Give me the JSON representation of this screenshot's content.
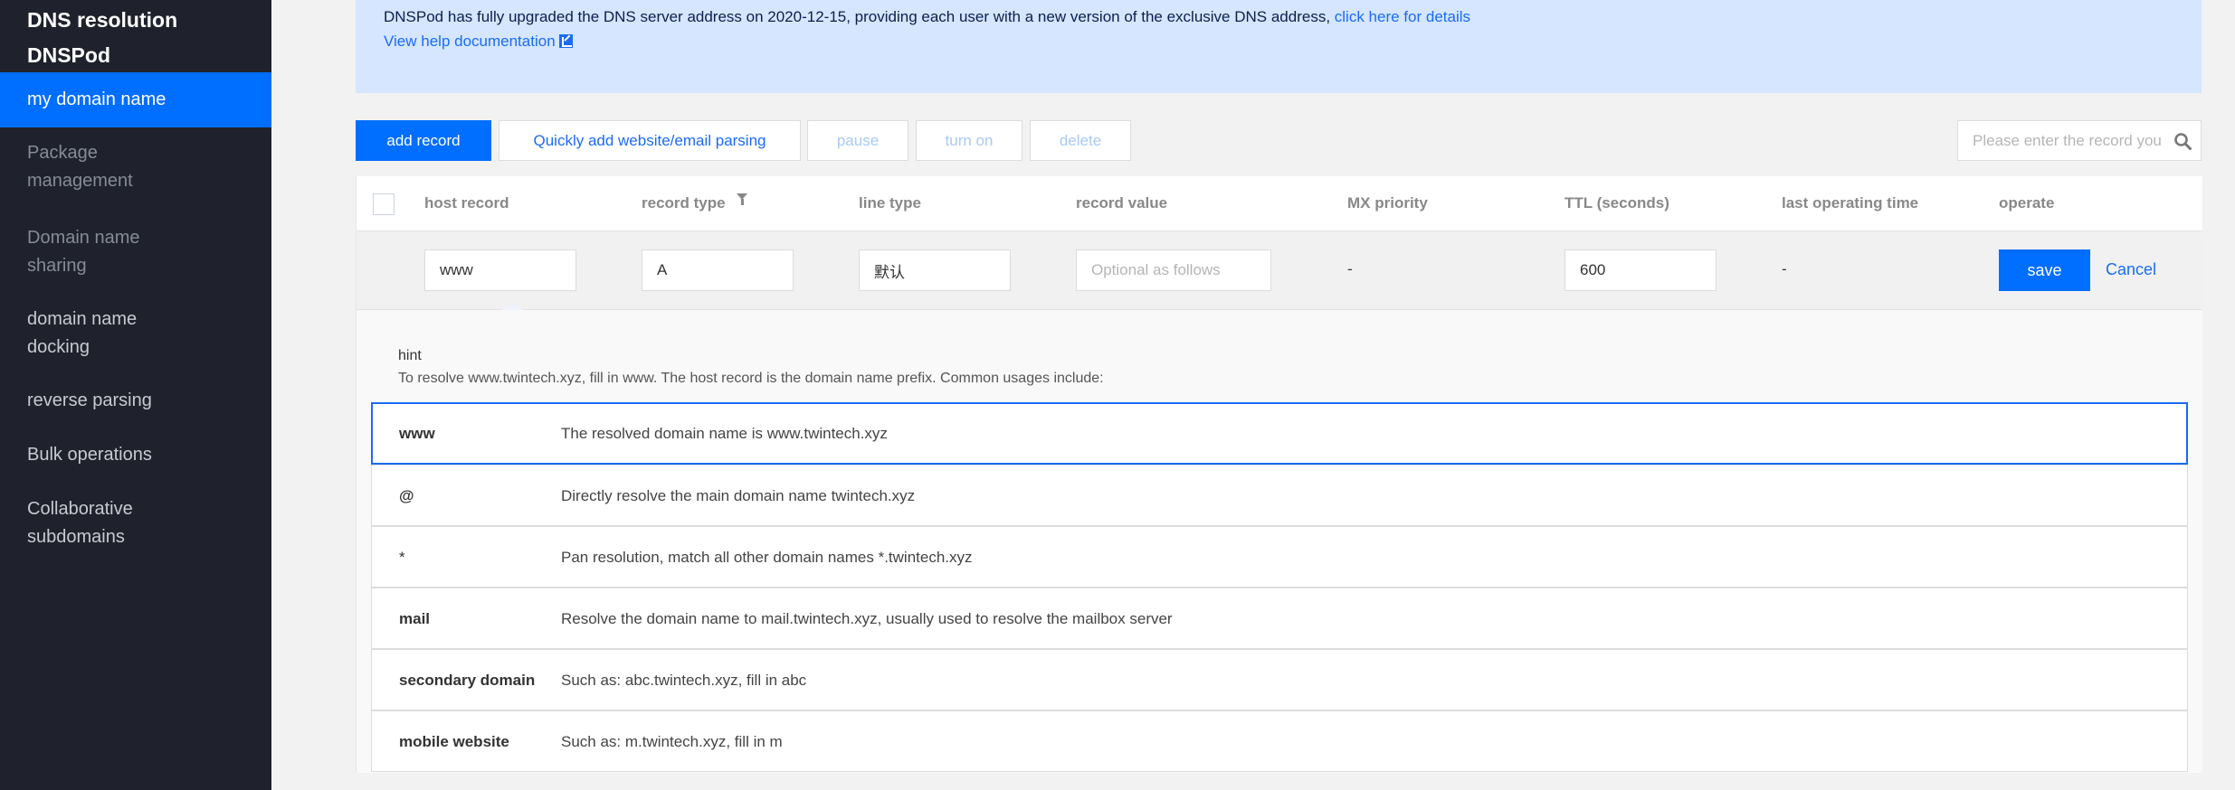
{
  "sidebar": {
    "title": "DNS resolution DNSPod",
    "items": [
      {
        "label": "my domain name",
        "active": true
      },
      {
        "label": "Package management",
        "muted": true
      },
      {
        "label": "Domain name sharing",
        "muted": true
      },
      {
        "label": "domain name docking"
      },
      {
        "label": "reverse parsing"
      },
      {
        "label": "Bulk operations"
      },
      {
        "label": "Collaborative subdomains"
      }
    ]
  },
  "notice": {
    "text": "DNSPod has fully upgraded the DNS server address on 2020-12-15, providing each user with a new version of the exclusive DNS address, ",
    "link": "click here for details",
    "help": "View help documentation",
    "icon": "external-link-icon",
    "close_icon": "close-icon"
  },
  "toolbar": {
    "add_record": "add record",
    "quick_add": "Quickly add website/email parsing",
    "pause": "pause",
    "turn_on": "turn on",
    "delete": "delete",
    "search_placeholder": "Please enter the record you want to search",
    "search_icon": "search-icon"
  },
  "table": {
    "columns": [
      "host record",
      "record type",
      "line type",
      "record value",
      "MX priority",
      "TTL (seconds)",
      "last operating time",
      "operate"
    ],
    "edit_row": {
      "host_record": "www",
      "record_type": "A",
      "line_type": "默认",
      "record_value_placeholder": "Optional as follows",
      "mx_priority": "-",
      "ttl": "600",
      "last_operating_time": "-",
      "save": "save",
      "cancel": "Cancel"
    }
  },
  "hint": {
    "title": "hint",
    "description": "To resolve www.twintech.xyz, fill in www. The host record is the domain name prefix. Common usages include:",
    "items": [
      {
        "key": "www",
        "value": "The resolved domain name is www.twintech.xyz"
      },
      {
        "key": "@",
        "value": "Directly resolve the main domain name twintech.xyz"
      },
      {
        "key": "*",
        "value": "Pan resolution, match all other domain names *.twintech.xyz"
      },
      {
        "key": "mail",
        "value": "Resolve the domain name to mail.twintech.xyz, usually used to resolve the mailbox server"
      },
      {
        "key": "secondary domain",
        "value": "Such as: abc.twintech.xyz, fill in abc"
      },
      {
        "key": "mobile website",
        "value": "Such as: m.twintech.xyz, fill in m"
      }
    ]
  },
  "colors": {
    "accent": "#006eff",
    "sidebar_bg": "#1f222c",
    "notice_bg": "#d5e6fe",
    "link": "#1a6cf5"
  }
}
